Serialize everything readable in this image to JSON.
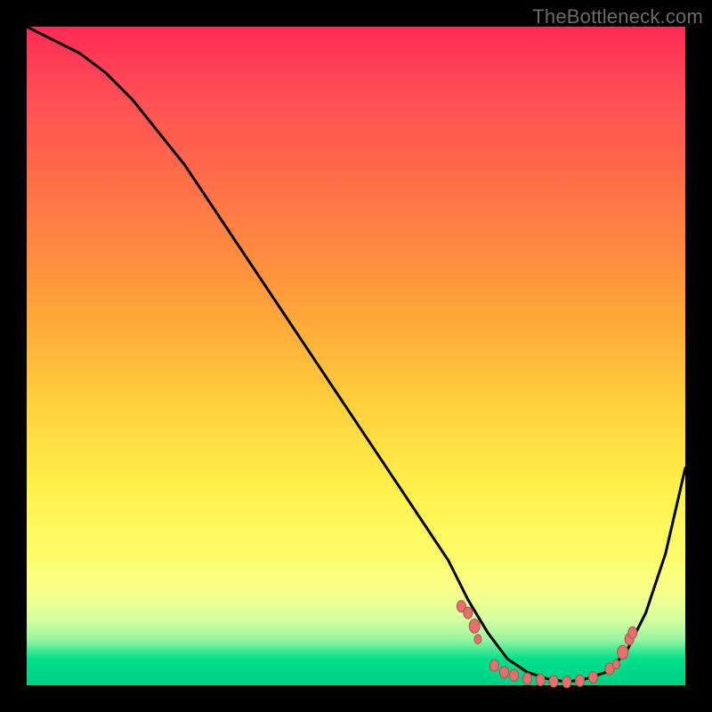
{
  "watermark": "TheBottleneck.com",
  "colors": {
    "frame": "#000000",
    "curve_stroke": "#000000",
    "marker_fill": "#e2726c",
    "marker_stroke": "#b74f49"
  },
  "chart_data": {
    "type": "line",
    "title": "",
    "xlabel": "",
    "ylabel": "",
    "xlim": [
      0,
      100
    ],
    "ylim": [
      0,
      100
    ],
    "grid": false,
    "legend": false,
    "series": [
      {
        "name": "bottleneck-curve",
        "x": [
          0,
          4,
          8,
          12,
          16,
          20,
          24,
          28,
          32,
          36,
          40,
          44,
          48,
          52,
          56,
          60,
          64,
          67,
          70,
          73,
          76,
          79,
          82,
          85,
          88,
          91,
          94,
          97,
          100
        ],
        "y": [
          100,
          98,
          96,
          93,
          89,
          84,
          79,
          73,
          67,
          61,
          55,
          49,
          43,
          37,
          31,
          25,
          19,
          13,
          8,
          4,
          2,
          1,
          0.5,
          1,
          2,
          5,
          11,
          20,
          33
        ]
      }
    ],
    "markers": {
      "name": "optimal-zone",
      "points": [
        {
          "x": 66,
          "y": 12,
          "r": 5
        },
        {
          "x": 67,
          "y": 11,
          "r": 5
        },
        {
          "x": 68,
          "y": 9,
          "r": 6
        },
        {
          "x": 68.5,
          "y": 7,
          "r": 4
        },
        {
          "x": 71,
          "y": 3,
          "r": 5
        },
        {
          "x": 72.5,
          "y": 2,
          "r": 5
        },
        {
          "x": 74,
          "y": 1.5,
          "r": 5
        },
        {
          "x": 76,
          "y": 1,
          "r": 5
        },
        {
          "x": 78,
          "y": 0.8,
          "r": 5
        },
        {
          "x": 80,
          "y": 0.6,
          "r": 5
        },
        {
          "x": 82,
          "y": 0.5,
          "r": 5
        },
        {
          "x": 84,
          "y": 0.7,
          "r": 5
        },
        {
          "x": 86,
          "y": 1.2,
          "r": 5
        },
        {
          "x": 88.5,
          "y": 2.5,
          "r": 5
        },
        {
          "x": 89.5,
          "y": 3.2,
          "r": 4
        },
        {
          "x": 90.5,
          "y": 5,
          "r": 6
        },
        {
          "x": 91.5,
          "y": 7,
          "r": 5
        },
        {
          "x": 92,
          "y": 8,
          "r": 5
        }
      ]
    }
  }
}
